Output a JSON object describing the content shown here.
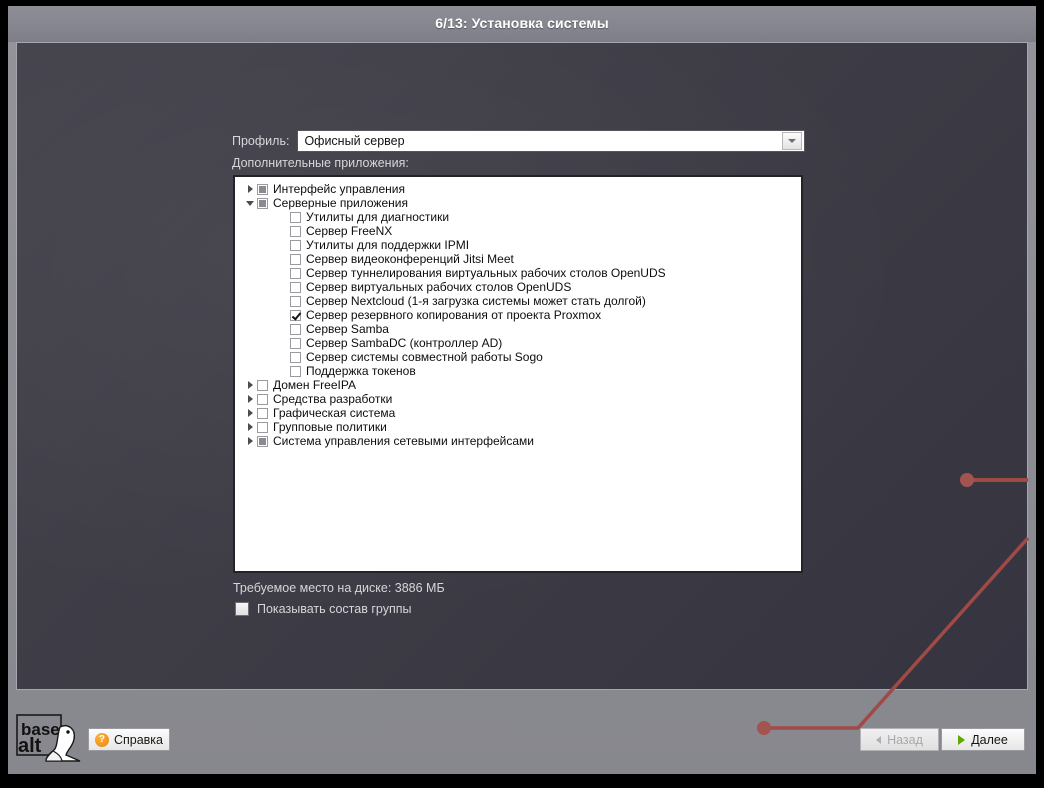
{
  "window": {
    "title": "6/13: Установка системы"
  },
  "form": {
    "profile_label": "Профиль:",
    "profile_value": "Офисный сервер",
    "apps_label": "Дополнительные приложения:"
  },
  "tree": {
    "items": [
      {
        "label": "Интерфейс управления",
        "level": 0,
        "twisty": "collapsed",
        "check": "partial"
      },
      {
        "label": "Серверные приложения",
        "level": 0,
        "twisty": "expanded",
        "check": "partial"
      },
      {
        "label": "Утилиты для диагностики",
        "level": 1,
        "twisty": "none",
        "check": "unchecked"
      },
      {
        "label": "Сервер FreeNX",
        "level": 1,
        "twisty": "none",
        "check": "unchecked"
      },
      {
        "label": "Утилиты для поддержки IPMI",
        "level": 1,
        "twisty": "none",
        "check": "unchecked"
      },
      {
        "label": "Сервер видеоконференций Jitsi Meet",
        "level": 1,
        "twisty": "none",
        "check": "unchecked"
      },
      {
        "label": "Сервер туннелирования виртуальных рабочих столов OpenUDS",
        "level": 1,
        "twisty": "none",
        "check": "unchecked"
      },
      {
        "label": "Сервер виртуальных рабочих столов OpenUDS",
        "level": 1,
        "twisty": "none",
        "check": "unchecked"
      },
      {
        "label": "Сервер Nextcloud (1-я загрузка системы может стать долгой)",
        "level": 1,
        "twisty": "none",
        "check": "unchecked"
      },
      {
        "label": "Сервер резервного копирования от проекта Proxmox",
        "level": 1,
        "twisty": "none",
        "check": "checked"
      },
      {
        "label": "Сервер Samba",
        "level": 1,
        "twisty": "none",
        "check": "unchecked"
      },
      {
        "label": "Сервер SambaDC (контроллер AD)",
        "level": 1,
        "twisty": "none",
        "check": "unchecked"
      },
      {
        "label": "Сервер системы совместной работы Sogo",
        "level": 1,
        "twisty": "none",
        "check": "unchecked"
      },
      {
        "label": "Поддержка токенов",
        "level": 1,
        "twisty": "none",
        "check": "unchecked"
      },
      {
        "label": "Домен FreeIPA",
        "level": 0,
        "twisty": "collapsed",
        "check": "unchecked"
      },
      {
        "label": "Средства разработки",
        "level": 0,
        "twisty": "collapsed",
        "check": "unchecked"
      },
      {
        "label": "Графическая система",
        "level": 0,
        "twisty": "collapsed",
        "check": "unchecked"
      },
      {
        "label": "Групповые политики",
        "level": 0,
        "twisty": "collapsed",
        "check": "unchecked"
      },
      {
        "label": "Система управления сетевыми интерфейсами",
        "level": 0,
        "twisty": "collapsed",
        "check": "partial"
      }
    ]
  },
  "status": {
    "disk_space": "Требуемое место на диске: 3886 МБ",
    "show_group_label": "Показывать состав группы"
  },
  "footer": {
    "logo_line1": "base",
    "logo_line2": "alt",
    "help_label": "Справка",
    "help_icon_glyph": "?",
    "back_label": "Назад",
    "next_label": "Далее"
  },
  "colors": {
    "titlebar": "#8a8a92",
    "panel_bg": "#3f3d46",
    "accent_green": "#5fa800",
    "accent_orange": "#e8860a",
    "decor_red": "#a64a47"
  }
}
